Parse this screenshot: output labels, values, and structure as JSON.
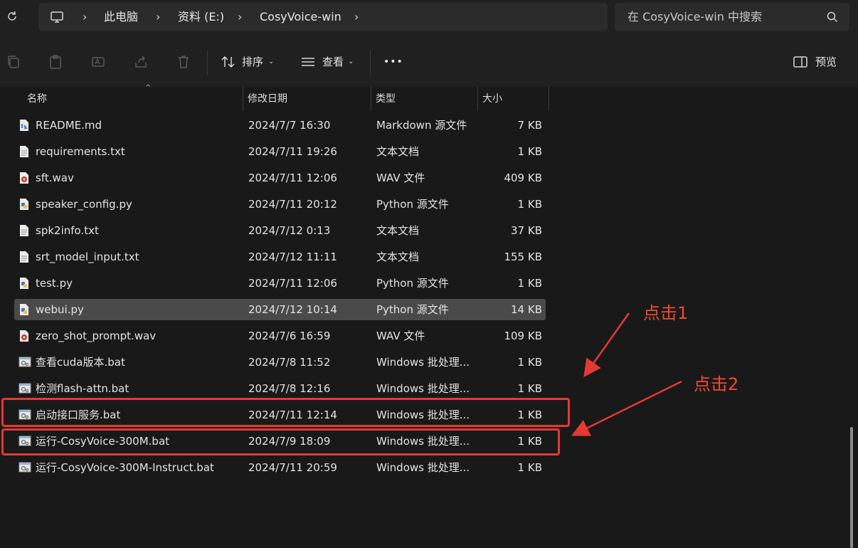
{
  "address_bar": {
    "breadcrumbs": [
      "此电脑",
      "资料 (E:)",
      "CosyVoice-win"
    ],
    "separator": "›"
  },
  "search": {
    "placeholder": "在 CosyVoice-win 中搜索"
  },
  "toolbar": {
    "sort_label": "排序",
    "view_label": "查看",
    "more_label": "•••",
    "preview_label": "预览"
  },
  "columns": {
    "name": "名称",
    "date": "修改日期",
    "type": "类型",
    "size": "大小"
  },
  "files": [
    {
      "name": "README.md",
      "date": "2024/7/7 16:30",
      "type": "Markdown 源文件",
      "size": "7 KB",
      "icon": "markdown-file-icon"
    },
    {
      "name": "requirements.txt",
      "date": "2024/7/11 19:26",
      "type": "文本文档",
      "size": "1 KB",
      "icon": "text-file-icon"
    },
    {
      "name": "sft.wav",
      "date": "2024/7/11 12:06",
      "type": "WAV 文件",
      "size": "409 KB",
      "icon": "audio-file-icon"
    },
    {
      "name": "speaker_config.py",
      "date": "2024/7/11 20:12",
      "type": "Python 源文件",
      "size": "1 KB",
      "icon": "python-file-icon"
    },
    {
      "name": "spk2info.txt",
      "date": "2024/7/12 0:13",
      "type": "文本文档",
      "size": "37 KB",
      "icon": "text-file-icon"
    },
    {
      "name": "srt_model_input.txt",
      "date": "2024/7/12 11:11",
      "type": "文本文档",
      "size": "155 KB",
      "icon": "text-file-icon"
    },
    {
      "name": "test.py",
      "date": "2024/7/11 12:06",
      "type": "Python 源文件",
      "size": "1 KB",
      "icon": "python-file-icon"
    },
    {
      "name": "webui.py",
      "date": "2024/7/12 10:14",
      "type": "Python 源文件",
      "size": "14 KB",
      "icon": "python-file-icon",
      "selected": true
    },
    {
      "name": "zero_shot_prompt.wav",
      "date": "2024/7/6 16:59",
      "type": "WAV 文件",
      "size": "109 KB",
      "icon": "audio-file-icon"
    },
    {
      "name": "查看cuda版本.bat",
      "date": "2024/7/8 11:52",
      "type": "Windows 批处理...",
      "size": "1 KB",
      "icon": "batch-file-icon"
    },
    {
      "name": "检测flash-attn.bat",
      "date": "2024/7/8 12:16",
      "type": "Windows 批处理...",
      "size": "1 KB",
      "icon": "batch-file-icon"
    },
    {
      "name": "启动接口服务.bat",
      "date": "2024/7/11 12:14",
      "type": "Windows 批处理...",
      "size": "1 KB",
      "icon": "batch-file-icon"
    },
    {
      "name": "运行-CosyVoice-300M.bat",
      "date": "2024/7/9 18:09",
      "type": "Windows 批处理...",
      "size": "1 KB",
      "icon": "batch-file-icon"
    },
    {
      "name": "运行-CosyVoice-300M-Instruct.bat",
      "date": "2024/7/11 20:59",
      "type": "Windows 批处理...",
      "size": "1 KB",
      "icon": "batch-file-icon"
    }
  ],
  "annotations": {
    "label_1": "点击1",
    "label_2": "点击2",
    "color": "#e53935"
  }
}
